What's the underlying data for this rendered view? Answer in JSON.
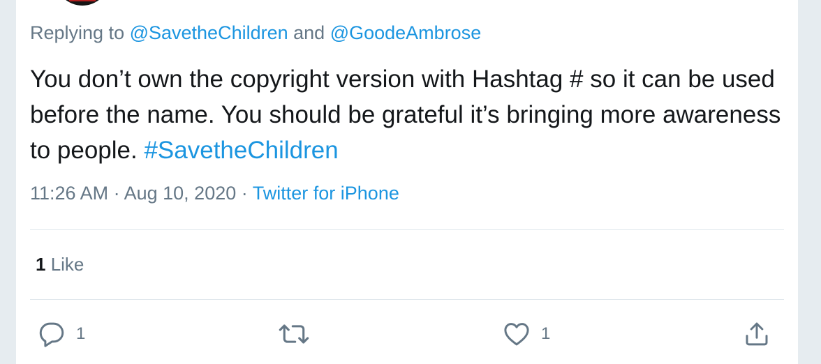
{
  "reply": {
    "prefix": "Replying to ",
    "mention_one": "@SavetheChildren",
    "connector": " and ",
    "mention_two": "@GoodeAmbrose"
  },
  "tweet": {
    "body": "You don’t own the copyright version with Hashtag # so it can be used before the name. You should be grateful it’s bringing more awareness to people. ",
    "hashtag": "#SavetheChildren"
  },
  "meta": {
    "time": "11:26 AM",
    "separator_one": " · ",
    "date": "Aug 10, 2020",
    "separator_two": " · ",
    "source": "Twitter for iPhone"
  },
  "stats": {
    "like_count": "1",
    "like_label": " Like"
  },
  "actions": {
    "reply_count": "1",
    "like_count": "1"
  },
  "colors": {
    "link": "#1b95e0",
    "text": "#14171a",
    "muted": "#657786",
    "divider": "#e1e8ed"
  },
  "icons": [
    "reply-icon",
    "retweet-icon",
    "like-icon",
    "share-icon"
  ]
}
